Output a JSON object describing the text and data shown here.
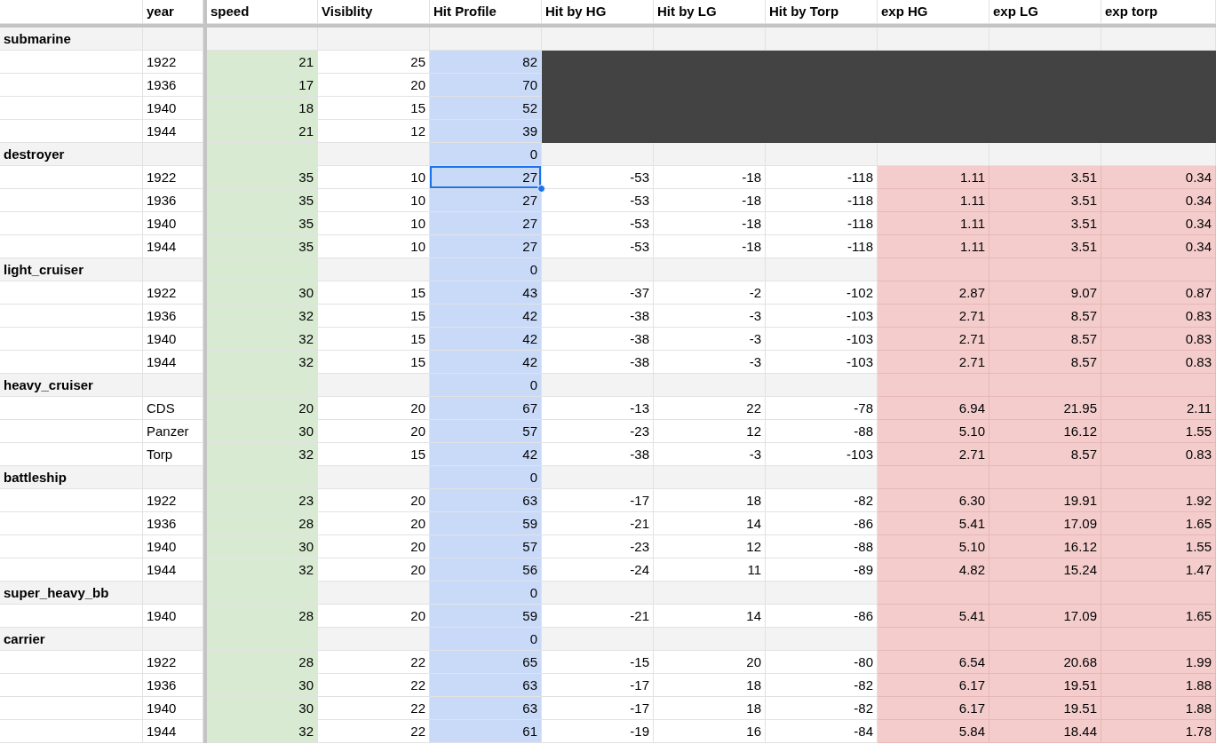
{
  "columns": [
    "year",
    "speed",
    "Visiblity",
    "Hit Profile",
    "Hit by HG",
    "Hit by LG",
    "Hit by Torp",
    "exp HG",
    "exp LG",
    "exp torp"
  ],
  "groups": [
    {
      "name": "submarine",
      "speed_shaded": false,
      "exp_shaded": false,
      "rows": [
        {
          "kind": "blacked_out",
          "selected": false,
          "cells": [
            "1922",
            "21",
            "25",
            "82"
          ]
        },
        {
          "kind": "blacked_out",
          "selected": false,
          "cells": [
            "1936",
            "17",
            "20",
            "70"
          ]
        },
        {
          "kind": "blacked_out",
          "selected": false,
          "cells": [
            "1940",
            "18",
            "15",
            "52"
          ]
        },
        {
          "kind": "blacked_out",
          "selected": false,
          "cells": [
            "1944",
            "21",
            "12",
            "39"
          ]
        }
      ]
    },
    {
      "name": "destroyer",
      "hit_profile": "0",
      "speed_shaded": true,
      "exp_shaded": false,
      "rows": [
        {
          "kind": "full",
          "selected": true,
          "cells": [
            "1922",
            "35",
            "10",
            "27",
            "-53",
            "-18",
            "-118",
            "1.11",
            "3.51",
            "0.34"
          ]
        },
        {
          "kind": "full",
          "selected": false,
          "cells": [
            "1936",
            "35",
            "10",
            "27",
            "-53",
            "-18",
            "-118",
            "1.11",
            "3.51",
            "0.34"
          ]
        },
        {
          "kind": "full",
          "selected": false,
          "cells": [
            "1940",
            "35",
            "10",
            "27",
            "-53",
            "-18",
            "-118",
            "1.11",
            "3.51",
            "0.34"
          ]
        },
        {
          "kind": "full",
          "selected": false,
          "cells": [
            "1944",
            "35",
            "10",
            "27",
            "-53",
            "-18",
            "-118",
            "1.11",
            "3.51",
            "0.34"
          ]
        }
      ]
    },
    {
      "name": "light_cruiser",
      "hit_profile": "0",
      "speed_shaded": true,
      "exp_shaded": true,
      "rows": [
        {
          "kind": "full",
          "selected": false,
          "cells": [
            "1922",
            "30",
            "15",
            "43",
            "-37",
            "-2",
            "-102",
            "2.87",
            "9.07",
            "0.87"
          ]
        },
        {
          "kind": "full",
          "selected": false,
          "cells": [
            "1936",
            "32",
            "15",
            "42",
            "-38",
            "-3",
            "-103",
            "2.71",
            "8.57",
            "0.83"
          ]
        },
        {
          "kind": "full",
          "selected": false,
          "cells": [
            "1940",
            "32",
            "15",
            "42",
            "-38",
            "-3",
            "-103",
            "2.71",
            "8.57",
            "0.83"
          ]
        },
        {
          "kind": "full",
          "selected": false,
          "cells": [
            "1944",
            "32",
            "15",
            "42",
            "-38",
            "-3",
            "-103",
            "2.71",
            "8.57",
            "0.83"
          ]
        }
      ]
    },
    {
      "name": "heavy_cruiser",
      "hit_profile": "0",
      "speed_shaded": true,
      "exp_shaded": true,
      "rows": [
        {
          "kind": "full",
          "selected": false,
          "cells": [
            "CDS",
            "20",
            "20",
            "67",
            "-13",
            "22",
            "-78",
            "6.94",
            "21.95",
            "2.11"
          ]
        },
        {
          "kind": "full",
          "selected": false,
          "cells": [
            "Panzer",
            "30",
            "20",
            "57",
            "-23",
            "12",
            "-88",
            "5.10",
            "16.12",
            "1.55"
          ]
        },
        {
          "kind": "full",
          "selected": false,
          "cells": [
            "Torp",
            "32",
            "15",
            "42",
            "-38",
            "-3",
            "-103",
            "2.71",
            "8.57",
            "0.83"
          ]
        }
      ]
    },
    {
      "name": "battleship",
      "hit_profile": "0",
      "speed_shaded": true,
      "exp_shaded": true,
      "rows": [
        {
          "kind": "full",
          "selected": false,
          "cells": [
            "1922",
            "23",
            "20",
            "63",
            "-17",
            "18",
            "-82",
            "6.30",
            "19.91",
            "1.92"
          ]
        },
        {
          "kind": "full",
          "selected": false,
          "cells": [
            "1936",
            "28",
            "20",
            "59",
            "-21",
            "14",
            "-86",
            "5.41",
            "17.09",
            "1.65"
          ]
        },
        {
          "kind": "full",
          "selected": false,
          "cells": [
            "1940",
            "30",
            "20",
            "57",
            "-23",
            "12",
            "-88",
            "5.10",
            "16.12",
            "1.55"
          ]
        },
        {
          "kind": "full",
          "selected": false,
          "cells": [
            "1944",
            "32",
            "20",
            "56",
            "-24",
            "11",
            "-89",
            "4.82",
            "15.24",
            "1.47"
          ]
        }
      ]
    },
    {
      "name": "super_heavy_bb",
      "hit_profile": "0",
      "speed_shaded": true,
      "exp_shaded": true,
      "rows": [
        {
          "kind": "full",
          "selected": false,
          "cells": [
            "1940",
            "28",
            "20",
            "59",
            "-21",
            "14",
            "-86",
            "5.41",
            "17.09",
            "1.65"
          ]
        }
      ]
    },
    {
      "name": "carrier",
      "hit_profile": "0",
      "speed_shaded": true,
      "exp_shaded": true,
      "rows": [
        {
          "kind": "full",
          "selected": false,
          "cells": [
            "1922",
            "28",
            "22",
            "65",
            "-15",
            "20",
            "-80",
            "6.54",
            "20.68",
            "1.99"
          ]
        },
        {
          "kind": "full",
          "selected": false,
          "cells": [
            "1936",
            "30",
            "22",
            "63",
            "-17",
            "18",
            "-82",
            "6.17",
            "19.51",
            "1.88"
          ]
        },
        {
          "kind": "full",
          "selected": false,
          "cells": [
            "1940",
            "30",
            "22",
            "63",
            "-17",
            "18",
            "-82",
            "6.17",
            "19.51",
            "1.88"
          ]
        },
        {
          "kind": "full",
          "selected": false,
          "cells": [
            "1944",
            "32",
            "22",
            "61",
            "-19",
            "16",
            "-84",
            "5.84",
            "18.44",
            "1.78"
          ]
        }
      ]
    }
  ]
}
